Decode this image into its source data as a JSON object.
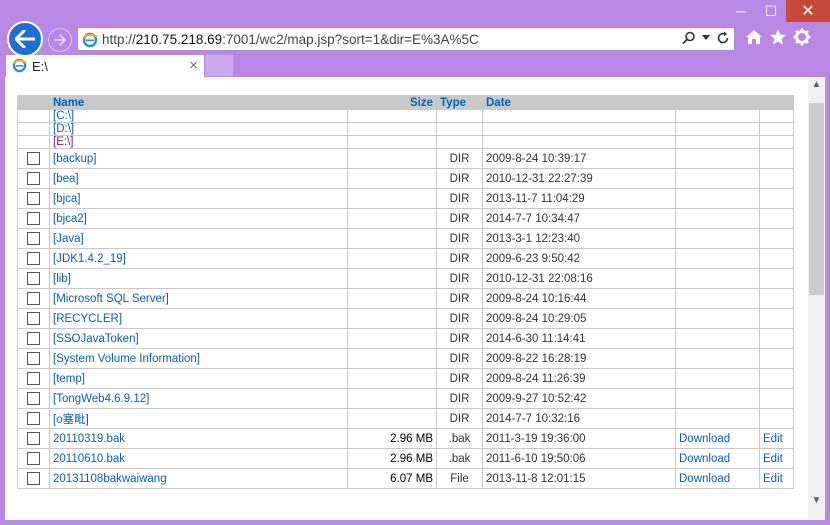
{
  "address": {
    "url_pre": "http://",
    "url_host": "210.75.218.69",
    "url_rest": ":7001/wc2/map.jsp?sort=1&dir=E%3A%5C"
  },
  "tab": {
    "title": "E:\\"
  },
  "captions": {
    "minimize": "─",
    "maximize": "☐",
    "close": "✕"
  },
  "headers": {
    "name": "Name",
    "size": "Size",
    "type": "Type",
    "date": "Date"
  },
  "drives": [
    {
      "label": "[C:\\]"
    },
    {
      "label": "[D:\\]"
    },
    {
      "label": "[E:\\]"
    }
  ],
  "rows": [
    {
      "name": "[backup]",
      "size": "",
      "type": "DIR",
      "date": "2009-8-24 10:39:17",
      "download": "",
      "edit": ""
    },
    {
      "name": "[bea]",
      "size": "",
      "type": "DIR",
      "date": "2010-12-31 22:27:39",
      "download": "",
      "edit": ""
    },
    {
      "name": "[bjca]",
      "size": "",
      "type": "DIR",
      "date": "2013-11-7 11:04:29",
      "download": "",
      "edit": ""
    },
    {
      "name": "[bjca2]",
      "size": "",
      "type": "DIR",
      "date": "2014-7-7 10:34:47",
      "download": "",
      "edit": ""
    },
    {
      "name": "[Java]",
      "size": "",
      "type": "DIR",
      "date": "2013-3-1 12:23:40",
      "download": "",
      "edit": ""
    },
    {
      "name": "[JDK1.4.2_19]",
      "size": "",
      "type": "DIR",
      "date": "2009-6-23 9:50:42",
      "download": "",
      "edit": ""
    },
    {
      "name": "[lib]",
      "size": "",
      "type": "DIR",
      "date": "2010-12-31 22:08:16",
      "download": "",
      "edit": ""
    },
    {
      "name": "[Microsoft SQL Server]",
      "size": "",
      "type": "DIR",
      "date": "2009-8-24 10:16:44",
      "download": "",
      "edit": ""
    },
    {
      "name": "[RECYCLER]",
      "size": "",
      "type": "DIR",
      "date": "2009-8-24 10:29:05",
      "download": "",
      "edit": ""
    },
    {
      "name": "[SSOJavaToken]",
      "size": "",
      "type": "DIR",
      "date": "2014-6-30 11:14:41",
      "download": "",
      "edit": ""
    },
    {
      "name": "[System Volume Information]",
      "size": "",
      "type": "DIR",
      "date": "2009-8-22 16:28:19",
      "download": "",
      "edit": ""
    },
    {
      "name": "[temp]",
      "size": "",
      "type": "DIR",
      "date": "2009-8-24 11:26:39",
      "download": "",
      "edit": ""
    },
    {
      "name": "[TongWeb4.6.9.12]",
      "size": "",
      "type": "DIR",
      "date": "2009-9-27 10:52:42",
      "download": "",
      "edit": ""
    },
    {
      "name": "[o塞毗]",
      "size": "",
      "type": "DIR",
      "date": "2014-7-7 10:32:16",
      "download": "",
      "edit": ""
    },
    {
      "name": "20110319.bak",
      "size": "2.96 MB",
      "type": ".bak",
      "date": "2011-3-19 19:36:00",
      "download": "Download",
      "edit": "Edit"
    },
    {
      "name": "20110610.bak",
      "size": "2.96 MB",
      "type": ".bak",
      "date": "2011-6-10 19:50:06",
      "download": "Download",
      "edit": "Edit"
    },
    {
      "name": "20131108bakwaiwang",
      "size": "6.07 MB",
      "type": "File",
      "date": "2013-11-8 12:01:15",
      "download": "Download",
      "edit": "Edit"
    }
  ]
}
